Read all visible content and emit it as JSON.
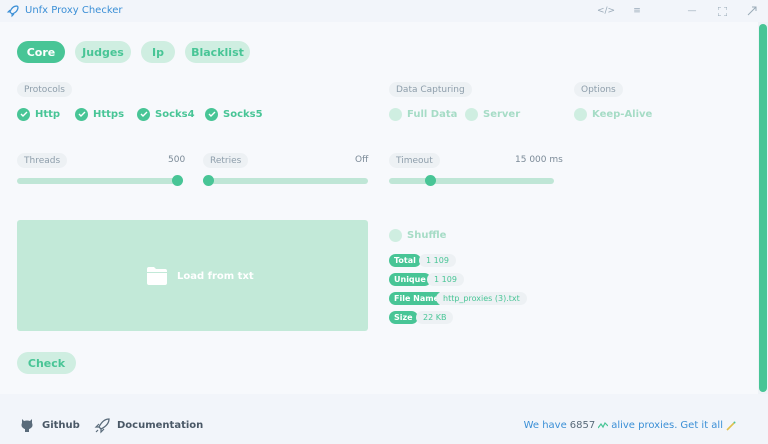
{
  "window": {
    "title": "Unfx Proxy Checker",
    "icons": [
      "rocket-icon",
      "code-icon",
      "menu-icon",
      "minimize-icon",
      "maximize-icon",
      "close-icon"
    ]
  },
  "tabs": [
    {
      "label": "Core",
      "active": true
    },
    {
      "label": "Judges",
      "active": false
    },
    {
      "label": "Ip",
      "active": false
    },
    {
      "label": "Blacklist",
      "active": false
    }
  ],
  "sections": {
    "protocols": "Protocols",
    "data_capturing": "Data Capturing",
    "options": "Options"
  },
  "protocols": [
    {
      "label": "Http",
      "checked": true
    },
    {
      "label": "Https",
      "checked": true
    },
    {
      "label": "Socks4",
      "checked": true
    },
    {
      "label": "Socks5",
      "checked": true
    }
  ],
  "data_capturing": [
    {
      "label": "Full Data",
      "checked": false
    },
    {
      "label": "Server",
      "checked": false
    }
  ],
  "options": [
    {
      "label": "Keep-Alive",
      "checked": false
    }
  ],
  "sliders": {
    "threads": {
      "label": "Threads",
      "value": "500",
      "fraction": 1.0
    },
    "retries": {
      "label": "Retries",
      "value": "Off",
      "fraction": 0.0
    },
    "timeout": {
      "label": "Timeout",
      "value": "15 000 ms",
      "fraction": 0.25
    }
  },
  "dropzone": {
    "label": "Load from txt"
  },
  "shuffle": {
    "label": "Shuffle",
    "checked": false
  },
  "info": [
    {
      "key": "Total",
      "value": "1 109"
    },
    {
      "key": "Unique",
      "value": "1 109"
    },
    {
      "key": "File Name",
      "value": "http_proxies (3).txt"
    },
    {
      "key": "Size",
      "value": "22 KB"
    }
  ],
  "check_button": "Check",
  "footer": {
    "github": "Github",
    "documentation": "Documentation",
    "status_prefix": "We have",
    "status_count": "6857",
    "status_middle": "alive proxies.",
    "status_link": "Get it all"
  },
  "colors": {
    "accent": "#48c596",
    "accent_light": "#cfeee1",
    "link": "#3b8fd6"
  }
}
